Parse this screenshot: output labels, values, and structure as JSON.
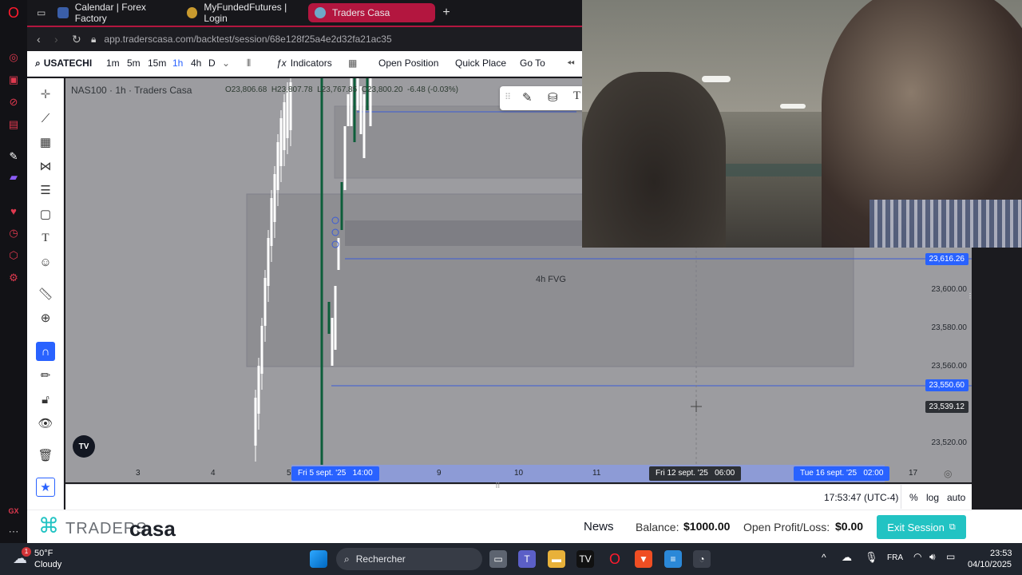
{
  "browser": {
    "tabs": [
      {
        "label": "Calendar | Forex Factory",
        "favicon_color": "#3a5ea8"
      },
      {
        "label": "MyFundedFutures | Login",
        "favicon_color": "#c99a2e"
      },
      {
        "label": "Traders Casa",
        "favicon_color": "#6fa8c7"
      }
    ],
    "url": "app.traderscasa.com/backtest/session/68e128f25a4e2d32fa21ac35"
  },
  "toolbar": {
    "symbol": "USATECHI",
    "timeframes": [
      "1m",
      "5m",
      "15m",
      "1h",
      "4h",
      "D"
    ],
    "active_timeframe": "1h",
    "indicators_label": "Indicators",
    "open_position_label": "Open Position",
    "quick_place_label": "Quick Place",
    "go_to_label": "Go To"
  },
  "chart": {
    "legend_title": "NAS100 · 1h · Traders Casa",
    "ohlc_o": "O23,806.68",
    "ohlc_h": "H23,807.78",
    "ohlc_l": "L23,767.85",
    "ohlc_c": "C23,800.20",
    "ohlc_change": "-6.48 (-0.03%)",
    "zone_label": "4h FVG",
    "y_ticks": [
      "23,600.00",
      "23,580.00",
      "23,560.00",
      "23,520.00"
    ],
    "price_badges": [
      {
        "value": "23,616.26",
        "color": "#2962ff"
      },
      {
        "value": "23,550.60",
        "color": "#2962ff"
      },
      {
        "value": "23,539.12",
        "color": "#2d3035"
      }
    ],
    "x_ticks": [
      "3",
      "4",
      "5",
      "9",
      "10",
      "11",
      "17"
    ],
    "x_highlights": [
      "Fri 5 sept. '25   14:00",
      "Fri 12 sept. '25   06:00",
      "Tue 16 sept. '25   02:00"
    ]
  },
  "status": {
    "clock": "17:53:47 (UTC-4)",
    "percent": "%",
    "log": "log",
    "auto": "auto"
  },
  "footer": {
    "brand_left": "TRADERS",
    "brand_right": "casa",
    "news": "News",
    "balance_label": "Balance:",
    "balance_value": "$1000.00",
    "pl_label": "Open Profit/Loss:",
    "pl_value": "$0.00",
    "exit_label": "Exit Session",
    "accent": "#22c3c3"
  },
  "taskbar": {
    "weather_temp": "50°F",
    "weather_desc": "Cloudy",
    "weather_badge": "1",
    "search_placeholder": "Rechercher",
    "lang": "FRA",
    "time": "23:53",
    "date": "04/10/2025"
  }
}
